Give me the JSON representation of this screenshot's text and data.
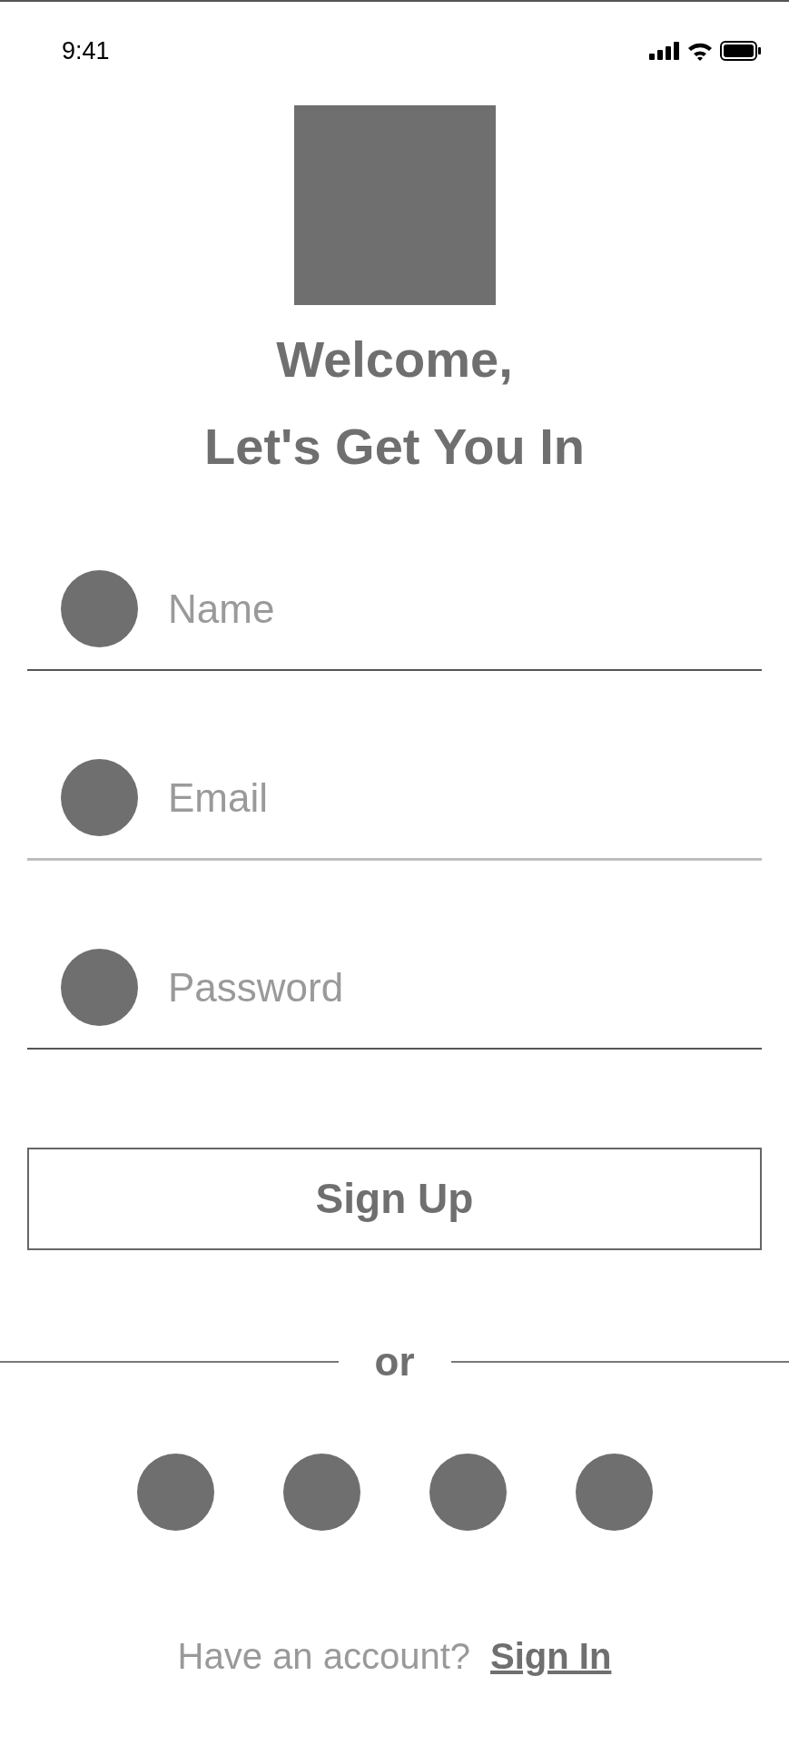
{
  "status_bar": {
    "time": "9:41"
  },
  "logo": {
    "kind": "placeholder"
  },
  "title": [
    "Welcome,",
    "Let's Get You In"
  ],
  "fields": [
    {
      "placeholder": "Name",
      "focused": false
    },
    {
      "placeholder": "Email",
      "focused": true
    },
    {
      "placeholder": "Password",
      "focused": false
    }
  ],
  "primary_button": {
    "label": "Sign Up"
  },
  "divider": {
    "label": "or"
  },
  "social_buttons": [
    {
      "kind": "circle"
    },
    {
      "kind": "circle"
    },
    {
      "kind": "circle"
    },
    {
      "kind": "circle"
    }
  ],
  "footer": {
    "prompt": "Have an account?",
    "link": "Sign In"
  }
}
